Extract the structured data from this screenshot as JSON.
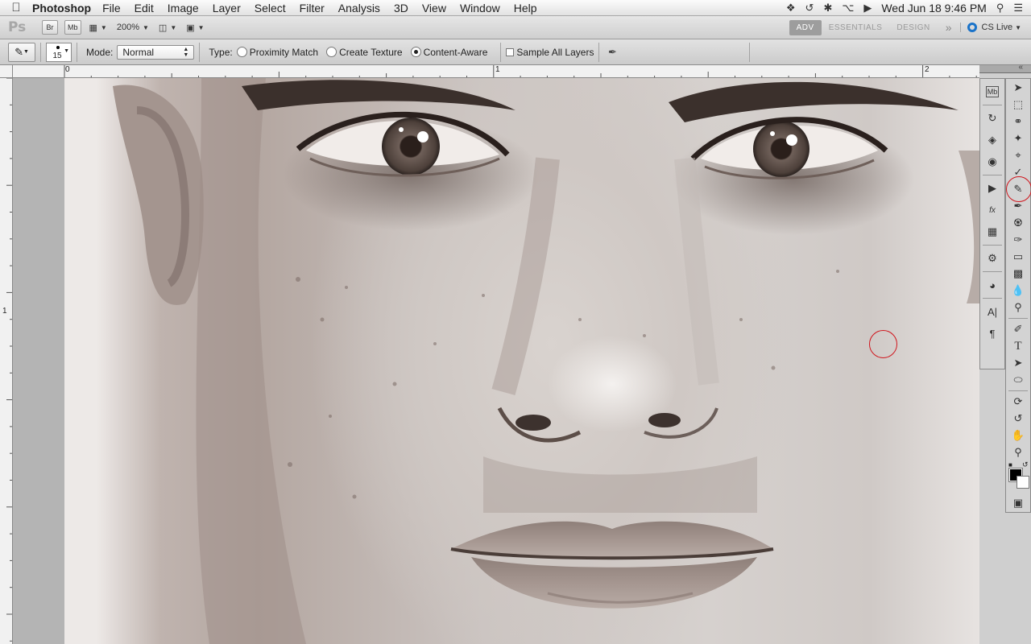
{
  "menubar": {
    "apple_icon": "apple-icon",
    "app_name": "Photoshop",
    "menus": [
      "File",
      "Edit",
      "Image",
      "Layer",
      "Select",
      "Filter",
      "Analysis",
      "3D",
      "View",
      "Window",
      "Help"
    ],
    "clock": "Wed Jun 18  9:46 PM",
    "status_icons": [
      "dropbox-icon",
      "time-machine-icon",
      "bluetooth-icon",
      "wifi-icon",
      "volume-icon",
      "search-icon",
      "list-icon"
    ]
  },
  "appbar": {
    "ps_label": "Ps",
    "bridge_label": "Br",
    "minibridge_label": "Mb",
    "zoom": "200%",
    "workspaces": [
      "ADV",
      "ESSENTIALS",
      "DESIGN"
    ],
    "active_workspace": "ADV",
    "more": "»",
    "cslive": "CS Live"
  },
  "options": {
    "brush_size": "15",
    "mode_label": "Mode:",
    "mode_value": "Normal",
    "type_label": "Type:",
    "types": [
      "Proximity Match",
      "Create Texture",
      "Content-Aware"
    ],
    "selected_type": "Content-Aware",
    "sample_all_layers": "Sample All Layers"
  },
  "rulers": {
    "top_labels": [
      "0",
      "1",
      "2"
    ],
    "left_labels": [
      "1"
    ]
  },
  "colors": {
    "highlight": "#d0161d",
    "foreground": "#000000",
    "background": "#ffffff"
  }
}
